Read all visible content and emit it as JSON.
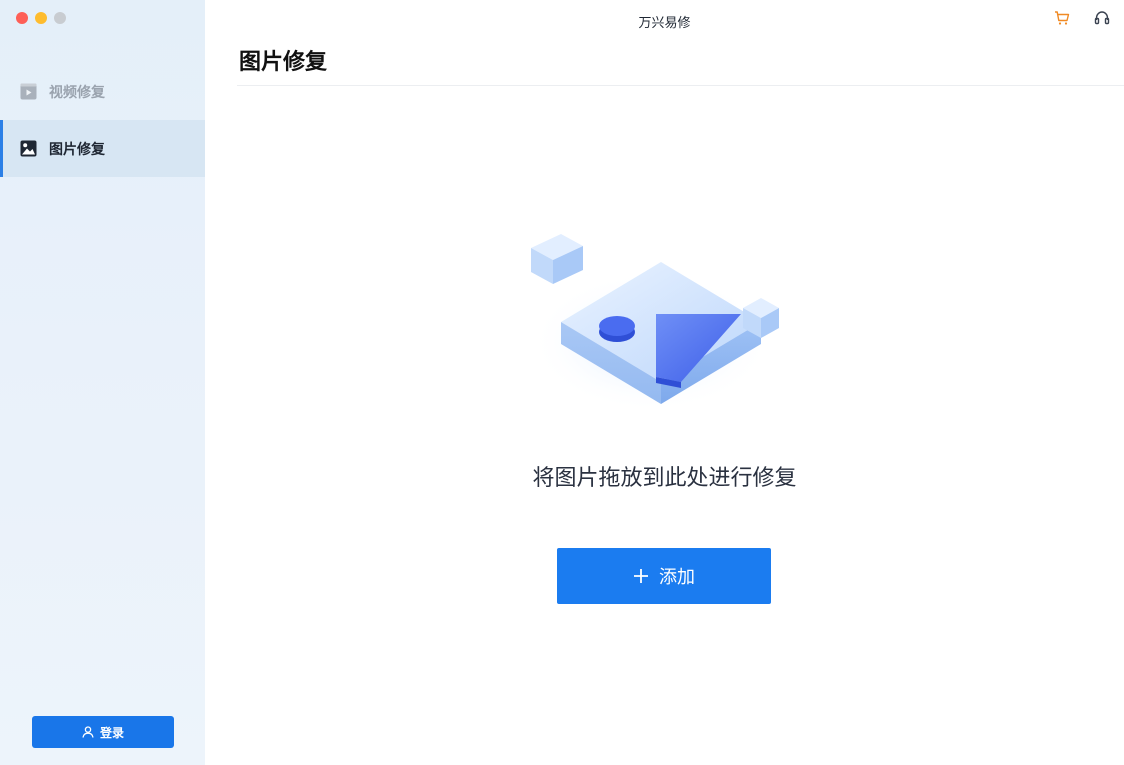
{
  "window": {
    "controls": [
      "close",
      "minimize",
      "zoom"
    ],
    "title": "万兴易修"
  },
  "sidebar": {
    "items": [
      {
        "label": "视频修复",
        "icon": "video-icon",
        "active": false
      },
      {
        "label": "图片修复",
        "icon": "image-icon",
        "active": true
      }
    ],
    "login_label": "登录",
    "login_icon": "user-icon"
  },
  "toolbar": {
    "icons": [
      "cart-icon",
      "headset-icon"
    ],
    "cart_color": "#f08a24"
  },
  "main": {
    "page_title": "图片修复",
    "drop_hint": "将图片拖放到此处进行修复",
    "add_button_label": "添加",
    "add_button_icon": "plus-icon",
    "illustration": "image-drop-illustration"
  },
  "colors": {
    "accent": "#1b7cf0",
    "sidebar_active_bg": "#d7e6f3",
    "active_indicator": "#2b7fe6"
  }
}
